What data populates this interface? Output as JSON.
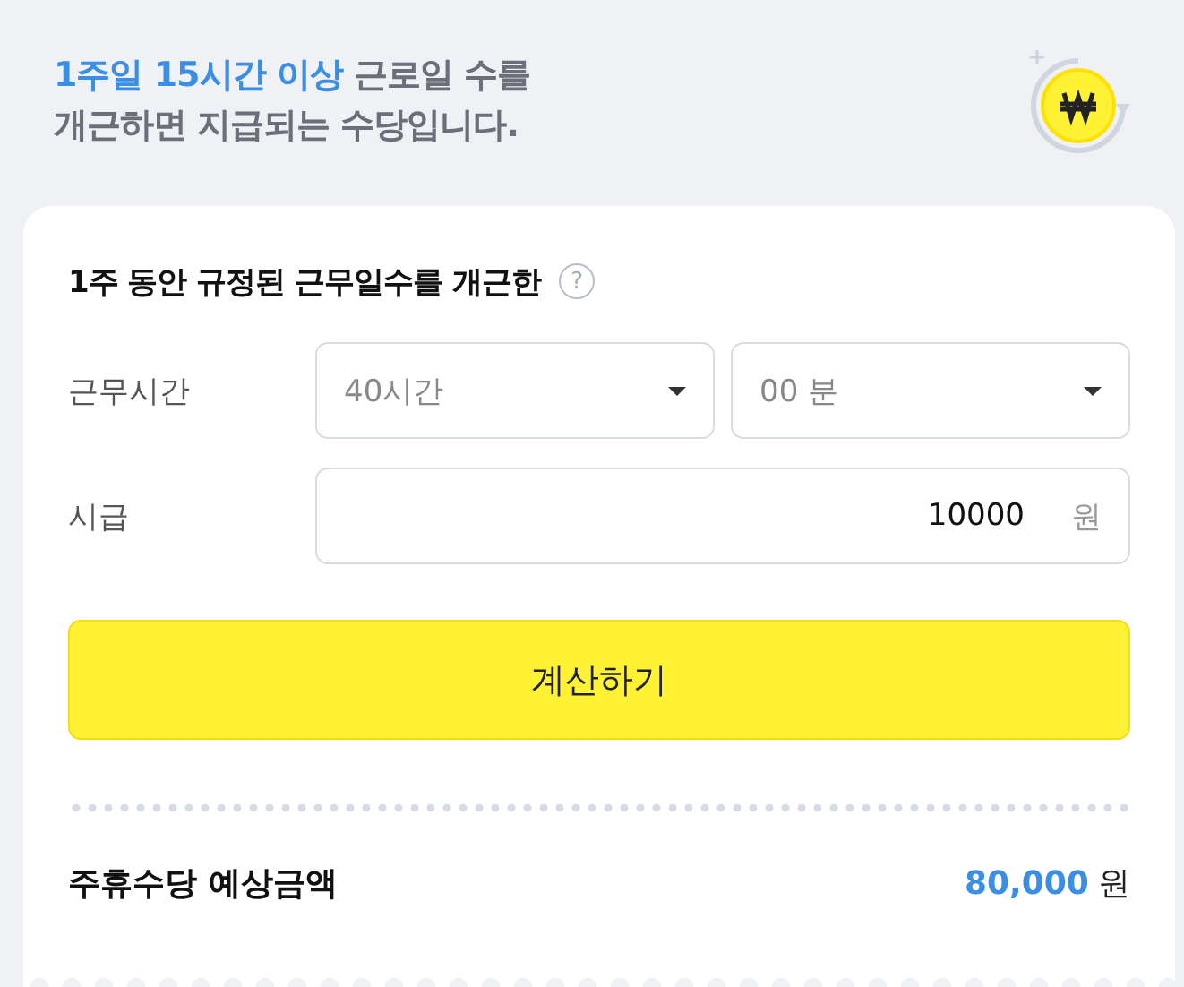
{
  "intro": {
    "lines": [
      "**1주일 15시간 이상** 근로일 수를",
      "개근하면 지급되는 수당입니다."
    ]
  },
  "card": {
    "title": "1주 동안 규정된 근무일수를 개근한",
    "help": "?",
    "fields": [
      {
        "kind": "selects",
        "label": "근무시간",
        "selects": [
          {
            "value": "40시간"
          },
          {
            "value": "00 분"
          }
        ]
      },
      {
        "kind": "input",
        "label": "시급",
        "value": "10000",
        "unit": "원"
      }
    ],
    "button": "계산하기",
    "result": {
      "label": "주휴수당 예상금액",
      "amount": "80,000",
      "unit": "원"
    }
  }
}
